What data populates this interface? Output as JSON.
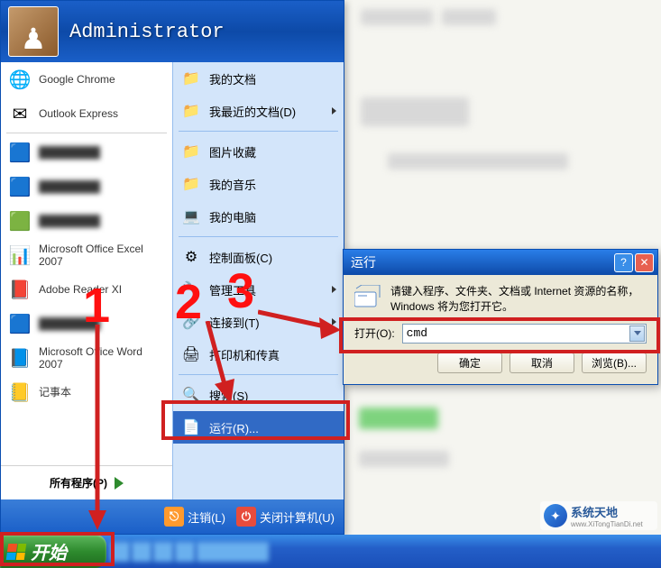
{
  "user": "Administrator",
  "left_items": [
    {
      "icon": "🌐",
      "label": "Google Chrome",
      "blurred_top": ""
    },
    {
      "icon": "✉",
      "label": "Outlook Express",
      "blurred_top": ""
    },
    {
      "icon": "🟦",
      "label": "",
      "blurred": true
    },
    {
      "icon": "🟦",
      "label": "",
      "blurred": true
    },
    {
      "icon": "🟩",
      "label": "",
      "blurred": true
    },
    {
      "icon": "📊",
      "label": "Microsoft Office Excel 2007"
    },
    {
      "icon": "📕",
      "label": "Adobe Reader XI"
    },
    {
      "icon": "🟦",
      "label": "",
      "blurred": true
    },
    {
      "icon": "📘",
      "label": "Microsoft Office Word 2007"
    },
    {
      "icon": "📒",
      "label": "记事本"
    }
  ],
  "all_programs": "所有程序(P)",
  "right_items": [
    {
      "icon": "📁",
      "label": "我的文档"
    },
    {
      "icon": "📁",
      "label": "我最近的文档(D)",
      "arrow": true
    },
    {
      "sep": true
    },
    {
      "icon": "📁",
      "label": "图片收藏"
    },
    {
      "icon": "📁",
      "label": "我的音乐"
    },
    {
      "icon": "💻",
      "label": "我的电脑"
    },
    {
      "sep": true
    },
    {
      "icon": "⚙",
      "label": "控制面板(C)"
    },
    {
      "icon": "🔧",
      "label": "管理工具",
      "arrow": true
    },
    {
      "icon": "🔗",
      "label": "连接到(T)",
      "arrow": true
    },
    {
      "icon": "🖨",
      "label": "打印机和传真"
    },
    {
      "sep": true
    },
    {
      "icon": "🔍",
      "label": "搜索(S)"
    },
    {
      "icon": "📄",
      "label": "运行(R)...",
      "selected": true
    }
  ],
  "footer": {
    "logoff": "注销(L)",
    "shutdown": "关闭计算机(U)"
  },
  "start_button": "开始",
  "run_dialog": {
    "title": "运行",
    "desc": "请键入程序、文件夹、文档或 Internet 资源的名称，Windows 将为您打开它。",
    "open_label": "打开(O):",
    "value": "cmd",
    "ok": "确定",
    "cancel": "取消",
    "browse": "浏览(B)..."
  },
  "annotations": {
    "n1": "1",
    "n2": "2",
    "n3": "3"
  },
  "watermark": {
    "text": "系统天地",
    "sub": "www.XiTongTianDi.net"
  }
}
